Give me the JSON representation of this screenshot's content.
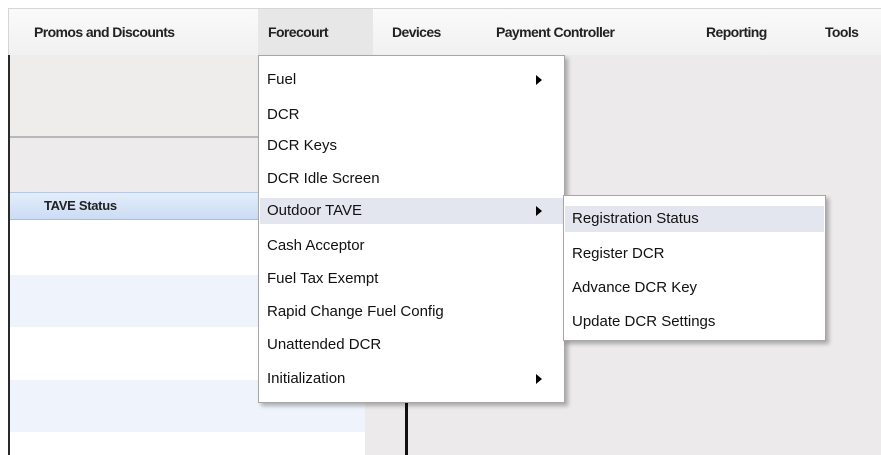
{
  "menubar": {
    "items": [
      {
        "label": "Promos and Discounts"
      },
      {
        "label": "Forecourt"
      },
      {
        "label": "Devices"
      },
      {
        "label": "Payment Controller"
      },
      {
        "label": "Reporting"
      },
      {
        "label": "Tools"
      }
    ]
  },
  "panel": {
    "header": "TAVE Status"
  },
  "forecourt_menu": {
    "items": [
      {
        "label": "Fuel",
        "submenu": true
      },
      {
        "label": "DCR",
        "submenu": false
      },
      {
        "label": "DCR Keys",
        "submenu": false
      },
      {
        "label": "DCR Idle Screen",
        "submenu": false
      },
      {
        "label": "Outdoor TAVE",
        "submenu": true
      },
      {
        "label": "Cash Acceptor",
        "submenu": false
      },
      {
        "label": "Fuel Tax Exempt",
        "submenu": false
      },
      {
        "label": "Rapid Change Fuel Config",
        "submenu": false
      },
      {
        "label": "Unattended DCR",
        "submenu": false
      },
      {
        "label": "Initialization",
        "submenu": true
      }
    ]
  },
  "tave_submenu": {
    "items": [
      {
        "label": "Registration Status"
      },
      {
        "label": "Register DCR"
      },
      {
        "label": "Advance DCR Key"
      },
      {
        "label": "Update DCR Settings"
      }
    ]
  }
}
